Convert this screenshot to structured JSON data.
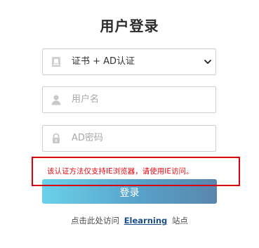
{
  "page": {
    "title": "用户登录"
  },
  "form": {
    "auth_method": {
      "selected": "证书 + AD认证"
    },
    "username": {
      "placeholder": "用户名"
    },
    "password": {
      "placeholder": "AD密码"
    },
    "warning": "该认证方法仅支持IE浏览器，请使用IE访问。",
    "login_button": "登录"
  },
  "footer": {
    "prefix": "点击此处访问",
    "link": "Elearning",
    "suffix": "站点"
  },
  "icons": {
    "select": "id-card-icon",
    "username": "user-icon",
    "password": "lock-icon",
    "dropdown": "chevron-down-icon"
  },
  "colors": {
    "warning_red": "#e30b16",
    "button_start": "#6bd1ea",
    "button_end": "#5a86ad",
    "link": "#1a4f8c"
  }
}
